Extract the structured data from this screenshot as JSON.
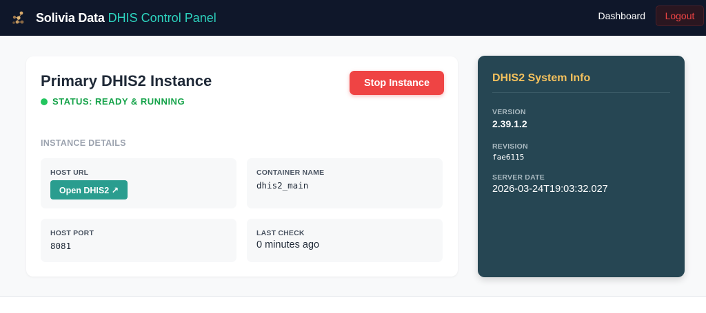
{
  "navbar": {
    "brand": "Solivia Data",
    "brand_accent": "DHIS Control Panel",
    "dashboard_link": "Dashboard",
    "logout_label": "Logout"
  },
  "instance": {
    "title": "Primary DHIS2 Instance",
    "status": "STATUS: READY & RUNNING",
    "stop_label": "Stop Instance",
    "details_heading": "INSTANCE DETAILS",
    "host_url_label": "HOST URL",
    "open_label": "Open DHIS2 ↗",
    "container_name_label": "CONTAINER NAME",
    "container_name": "dhis2_main",
    "host_port_label": "HOST PORT",
    "host_port": "8081",
    "last_check_label": "LAST CHECK",
    "last_check": "0 minutes ago"
  },
  "system_info": {
    "title": "DHIS2 System Info",
    "version_label": "VERSION",
    "version": "2.39.1.2",
    "revision_label": "REVISION",
    "revision": "fae6115",
    "server_date_label": "SERVER DATE",
    "server_date": "2026-03-24T19:03:32.027"
  },
  "colors": {
    "navbar_bg": "#0f172a",
    "accent_teal": "#2dd4bf",
    "danger": "#ef4444",
    "success": "#22c55e",
    "panel_bg": "#264653",
    "panel_title": "#f4c15d",
    "open_button": "#2a9d8f"
  },
  "icons": {
    "logo": "network-nodes-icon"
  }
}
